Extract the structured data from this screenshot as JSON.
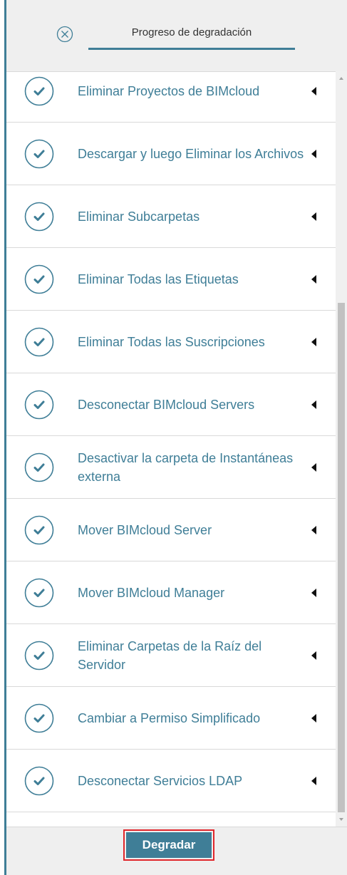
{
  "header": {
    "tab_label": "Progreso de degradación",
    "close_icon": "circle-x-icon"
  },
  "steps": [
    {
      "label": "Eliminar Proyectos de BIMcloud",
      "status": "done",
      "icon": "check-circle-icon"
    },
    {
      "label": "Descargar y luego Eliminar los Archivos",
      "status": "done",
      "icon": "check-circle-icon"
    },
    {
      "label": "Eliminar Subcarpetas",
      "status": "done",
      "icon": "check-circle-icon"
    },
    {
      "label": "Eliminar Todas las Etiquetas",
      "status": "done",
      "icon": "check-circle-icon"
    },
    {
      "label": "Eliminar Todas las Suscripciones",
      "status": "done",
      "icon": "check-circle-icon"
    },
    {
      "label": "Desconectar BIMcloud Servers",
      "status": "done",
      "icon": "check-circle-icon"
    },
    {
      "label": "Desactivar la carpeta de Instantáneas externa",
      "status": "done",
      "icon": "check-circle-icon"
    },
    {
      "label": "Mover BIMcloud Server",
      "status": "done",
      "icon": "check-circle-icon"
    },
    {
      "label": "Mover BIMcloud Manager",
      "status": "done",
      "icon": "check-circle-icon"
    },
    {
      "label": "Eliminar Carpetas de la Raíz del Servidor",
      "status": "done",
      "icon": "check-circle-icon"
    },
    {
      "label": "Cambiar a Permiso Simplificado",
      "status": "done",
      "icon": "check-circle-icon"
    },
    {
      "label": "Desconectar Servicios LDAP",
      "status": "done",
      "icon": "check-circle-icon"
    }
  ],
  "footer": {
    "downgrade_label": "Degradar"
  },
  "colors": {
    "accent": "#3f7e97",
    "highlight_border": "#e0262b",
    "header_bg": "#efefef"
  }
}
